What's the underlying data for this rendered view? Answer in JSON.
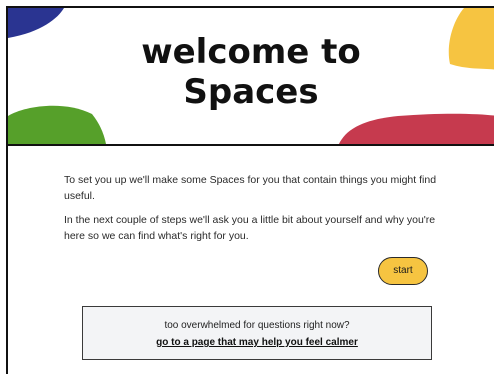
{
  "hero": {
    "title_line1": "welcome to",
    "title_line2": "Spaces"
  },
  "intro": {
    "paragraph1": "To set you up we'll make some Spaces for you that contain things you might find useful.",
    "paragraph2": "In the next couple of steps we'll ask you a little bit about yourself and why you're here so we can find what's right for you."
  },
  "actions": {
    "start_label": "start"
  },
  "calm": {
    "question": "too overwhelmed for questions right now?",
    "link_text": "go to a page that may help you feel calmer"
  },
  "colors": {
    "blue": "#2a3491",
    "yellow": "#f6c441",
    "green": "#56a02a",
    "red": "#c63a4e",
    "button": "#f6c441",
    "calm_box_bg": "#f3f4f6"
  }
}
